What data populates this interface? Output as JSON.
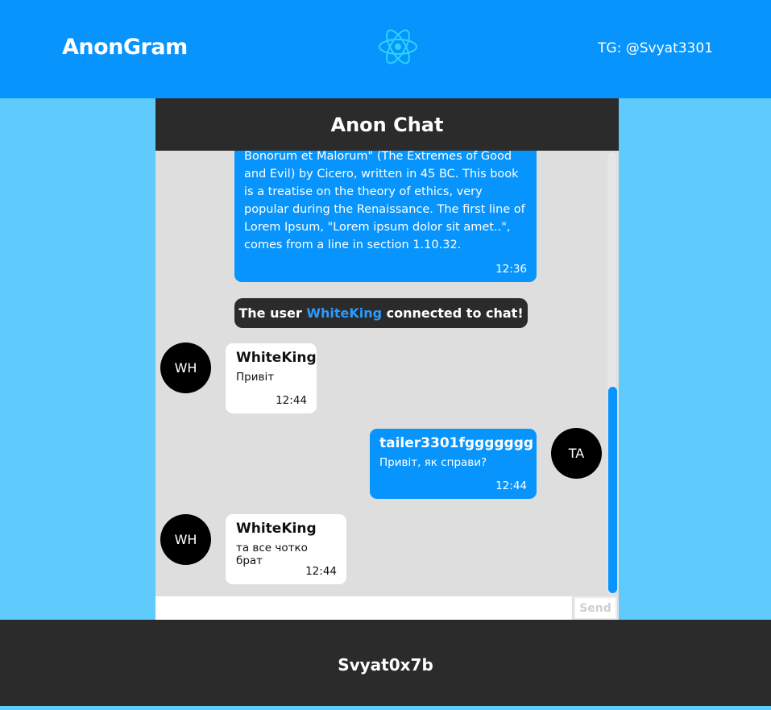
{
  "header": {
    "brand": "AnonGram",
    "logo_icon": "react-logo-icon",
    "contact": "TG: @Svyat3301",
    "color": "#0794fc"
  },
  "chat": {
    "title": "Anon Chat",
    "messages": [
      {
        "direction": "out",
        "text": "Bonorum et Malorum\" (The Extremes of Good and Evil) by Cicero, written in 45 BC. This book is a treatise on the theory of ethics, very popular during the Renaissance. The first line of Lorem Ipsum, \"Lorem ipsum dolor sit amet..\", comes from a line in section 1.10.32.",
        "time": "12:36"
      },
      {
        "direction": "system",
        "prefix": "The user",
        "username": "WhiteKing",
        "suffix": "connected to chat!"
      },
      {
        "direction": "in",
        "avatar": "WH",
        "sender": "WhiteKing",
        "text": "Привіт",
        "time": "12:44"
      },
      {
        "direction": "out",
        "avatar": "TA",
        "sender": "tailer3301fggggggg",
        "text": "Привіт, як справи?",
        "time": "12:44"
      },
      {
        "direction": "in",
        "avatar": "WH",
        "sender": "WhiteKing",
        "text": "та все чотко брат",
        "time": "12:44"
      }
    ],
    "input": {
      "value": "",
      "placeholder": ""
    },
    "send_label": "Send"
  },
  "footer": {
    "text": "Svyat0x7b"
  },
  "colors": {
    "background": "#5ecbfc",
    "dark": "#2b2b2b",
    "chat_bg": "#dedede",
    "highlight": "#2b9cfd"
  }
}
